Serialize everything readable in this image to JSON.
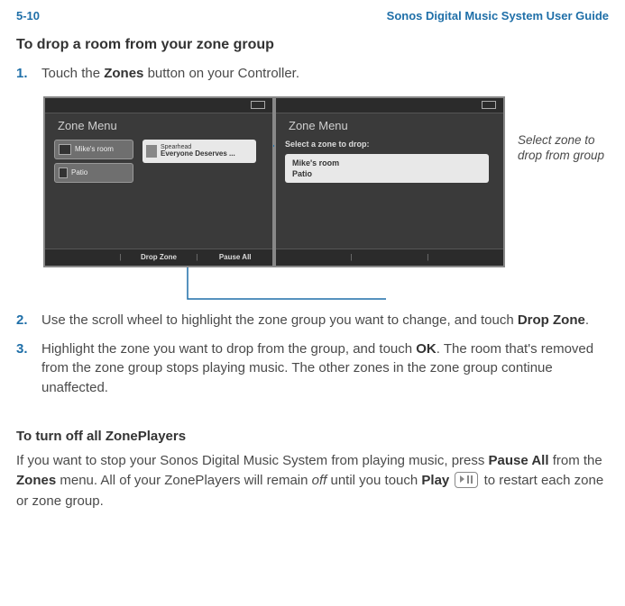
{
  "header": {
    "page": "5-10",
    "book": "Sonos Digital Music System User Guide"
  },
  "section1": {
    "title": "To drop a room from your zone group",
    "step1_num": "1.",
    "step1_a": "Touch the ",
    "step1_b": "Zones",
    "step1_c": " button on your Controller.",
    "step2_num": "2.",
    "step2_a": "Use the scroll wheel to highlight the zone group you want to change, and touch ",
    "step2_b": "Drop Zone",
    "step2_c": ".",
    "step3_num": "3.",
    "step3_a": "Highlight the zone you want to drop from the group, and touch ",
    "step3_b": "OK",
    "step3_c": ". The room that's removed from the zone group stops playing music. The other zones in the zone group continue unaffected."
  },
  "screens": {
    "left_title": "Zone Menu",
    "zone1": "Mike's room",
    "zone2": "Patio",
    "np_artist": "Spearhead",
    "np_song": "Everyone Deserves ...",
    "footer_drop": "Drop Zone",
    "footer_pause": "Pause All",
    "right_title": "Zone Menu",
    "right_prompt": "Select a zone to drop:",
    "drop_opt1": "Mike's room",
    "drop_opt2": "Patio"
  },
  "caption": "Select zone to drop from group",
  "section2": {
    "title": "To turn off all ZonePlayers",
    "p1": "If you want to stop your Sonos Digital Music System from playing music, press ",
    "p2": "Pause All",
    "p3": " from the ",
    "p4": "Zones",
    "p5": " menu. All of your ZonePlayers will remain ",
    "p6": "off",
    "p7": " until you touch ",
    "p8": "Play",
    "p9": " to restart each zone or zone group."
  }
}
